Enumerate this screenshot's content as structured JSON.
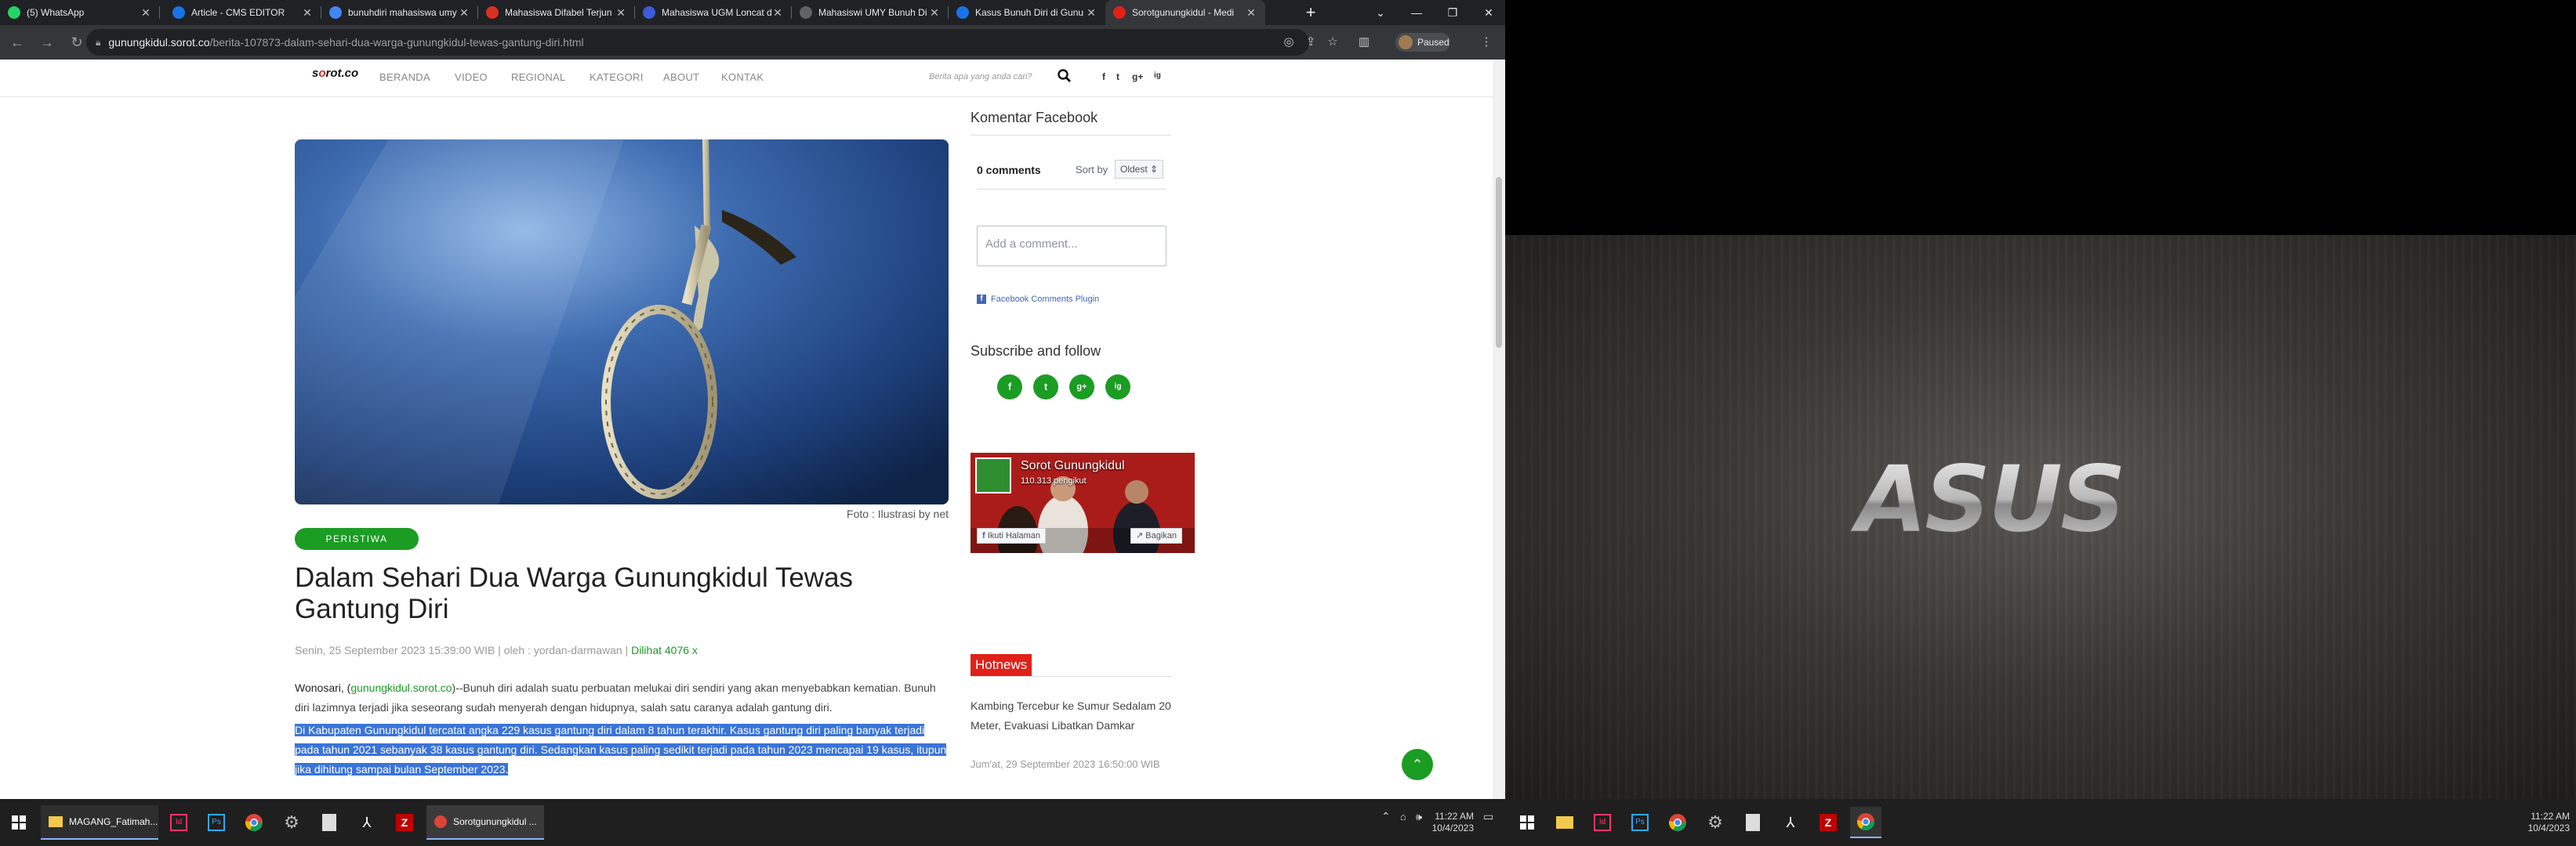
{
  "browser": {
    "tabs": [
      {
        "title": "(5) WhatsApp",
        "icon": "whatsapp-icon",
        "color": "#25d366"
      },
      {
        "title": "Article - CMS EDITOR",
        "icon": "p-letter-icon",
        "color": "#1a73e8"
      },
      {
        "title": "bunuhdiri mahasiswa umy",
        "icon": "google-icon",
        "color": "#4285f4"
      },
      {
        "title": "Mahasiswa Difabel Terjun",
        "icon": "red-circle-icon",
        "color": "#d93025"
      },
      {
        "title": "Mahasiswa UGM Loncat d",
        "icon": "blue-circle-icon",
        "color": "#3b5bdb"
      },
      {
        "title": "Mahasiswi UMY Bunuh Di",
        "icon": "doc-icon",
        "color": "#5f6368"
      },
      {
        "title": "Kasus Bunuh Diri di Gunu",
        "icon": "flag-icon",
        "color": "#1a73e8"
      },
      {
        "title": "Sorotgunungkidul - Medi",
        "icon": "sorot-icon",
        "color": "#e0211a"
      }
    ],
    "url_host": "gunungkidul.sorot.co",
    "url_path": "/berita-107873-dalam-sehari-dua-warga-gunungkidul-tewas-gantung-diri.html",
    "profile_status": "Paused"
  },
  "site": {
    "logo_pre": "s",
    "logo_o": "o",
    "logo_post": "rot.co",
    "nav": [
      "BERANDA",
      "VIDEO",
      "REGIONAL",
      "KATEGORI",
      "ABOUT",
      "KONTAK"
    ],
    "search_placeholder": "Berita apa yang anda cari?",
    "social": [
      "f",
      "t",
      "g+",
      "ig"
    ]
  },
  "article": {
    "photo_caption": "Foto : Ilustrasi by net",
    "category": "PERISTIWA",
    "title": "Dalam Sehari Dua Warga Gunungkidul Tewas Gantung Diri",
    "meta_date": "Senin, 25 September 2023 15:39:00 WIB | oleh : yordan-darmawan | ",
    "meta_views": "Dilihat 4076 x",
    "p1_lead": "Wonosari, (",
    "p1_link": "gunungkidul.sorot.co",
    "p1_rest": ")--Bunuh diri adalah suatu perbuatan melukai diri sendiri yang akan menyebabkan kematian. Bunuh diri lazimnya terjadi jika seseorang sudah menyerah dengan hidupnya, salah satu caranya adalah gantung diri.",
    "p2": "Di Kabupaten Gunungkidul tercatat angka 229 kasus gantung diri dalam 8 tahun terakhir. Kasus gantung diri paling banyak terjadi pada tahun 2021 sebanyak 38 kasus gantung diri. Sedangkan kasus paling sedikit terjadi pada tahun 2023 mencapai 19 kasus, itupun jika dihitung sampai bulan September 2023."
  },
  "sidebar": {
    "fb_heading": "Komentar Facebook",
    "fb_count": "0 comments",
    "fb_sort_label": "Sort by",
    "fb_sort_value": "Oldest",
    "fb_placeholder": "Add a comment...",
    "fb_plugin": "Facebook Comments Plugin",
    "subscribe_heading": "Subscribe and follow",
    "subscribe_icons": [
      "f",
      "t",
      "g+",
      "ig"
    ],
    "fb_page_name": "Sorot Gunungkidul",
    "fb_page_followers": "110.313 pengikut",
    "fb_follow_btn": "Ikuti Halaman",
    "fb_share_btn": "Bagikan",
    "hot_heading": "Hotnews",
    "hot_item": "Kambing Tercebur ke Sumur Sedalam 20 Meter, Evakuasi Libatkan Damkar",
    "hot_date": "Jum'at, 29 September 2023 16:50:00 WIB"
  },
  "taskbar1": {
    "items": [
      "MAGANG_Fatimah...",
      "Sorotgunungkidul ..."
    ],
    "time": "11:22 AM",
    "date": "10/4/2023"
  },
  "taskbar2": {
    "time": "11:22 AM",
    "date": "10/4/2023"
  },
  "desktop": {
    "brand": "ASUS"
  }
}
